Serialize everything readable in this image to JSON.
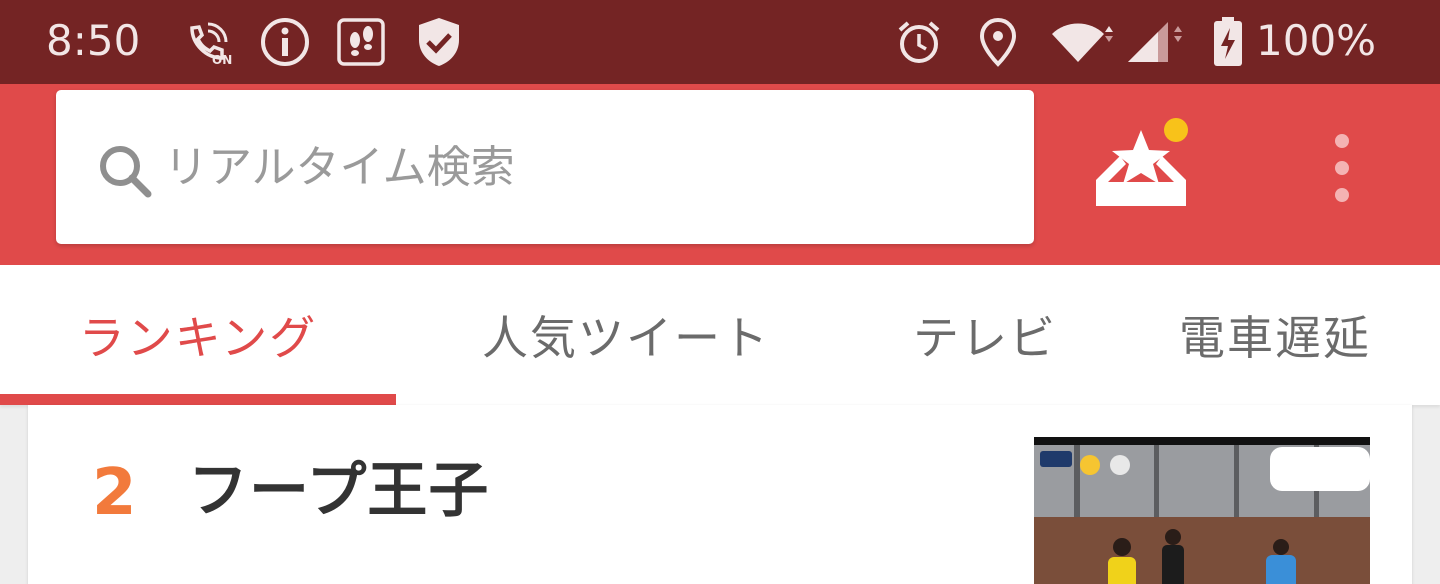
{
  "status_bar": {
    "time": "8:50",
    "battery_percent": "100%",
    "left_icons": [
      "wifi-calling-icon",
      "info-icon",
      "footsteps-icon",
      "shield-check-icon"
    ],
    "right_icons": [
      "alarm-icon",
      "location-icon",
      "wifi-icon",
      "signal-icon",
      "battery-charging-icon"
    ]
  },
  "search": {
    "placeholder": "リアルタイム検索"
  },
  "toolbar": {
    "favorite_icon": "star-tray-icon",
    "more_icon": "more-vert-icon"
  },
  "tabs": [
    {
      "label": "ランキング",
      "active": true
    },
    {
      "label": "人気ツイート",
      "active": false
    },
    {
      "label": "テレビ",
      "active": false
    },
    {
      "label": "電車遅延",
      "active": false
    }
  ],
  "ranking_item": {
    "rank": "2",
    "title": "フープ王子"
  },
  "colors": {
    "status_bar": "#742424",
    "brand_red": "#e04a4a",
    "rank_orange": "#f27a3c",
    "notification_dot": "#f8c21a"
  }
}
